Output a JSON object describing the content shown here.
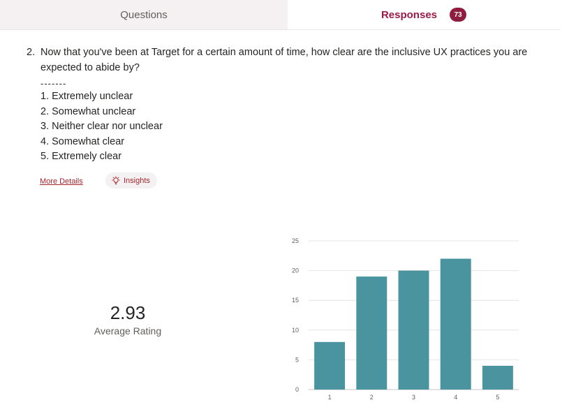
{
  "tabs": {
    "questions_label": "Questions",
    "responses_label": "Responses",
    "responses_count": "73"
  },
  "question": {
    "number": "2.",
    "text": "Now that you've been at Target for a certain amount of time, how clear are the inclusive UX practices you are expected to abide by?",
    "separator": "-------",
    "options": [
      "1. Extremely unclear",
      "2. Somewhat unclear",
      "3. Neither clear nor unclear",
      "4. Somewhat clear",
      "5. Extremely clear"
    ]
  },
  "actions": {
    "more_details": "More Details",
    "insights": "Insights"
  },
  "summary": {
    "average_value": "2.93",
    "average_label": "Average Rating"
  },
  "colors": {
    "accent": "#9b1b45",
    "bar": "#4a94a0"
  },
  "chart_data": {
    "type": "bar",
    "categories": [
      "1",
      "2",
      "3",
      "4",
      "5"
    ],
    "values": [
      8,
      19,
      20,
      22,
      4
    ],
    "title": "",
    "xlabel": "",
    "ylabel": "",
    "ylim": [
      0,
      25
    ],
    "yticks": [
      0,
      5,
      10,
      15,
      20,
      25
    ],
    "grid": true
  }
}
